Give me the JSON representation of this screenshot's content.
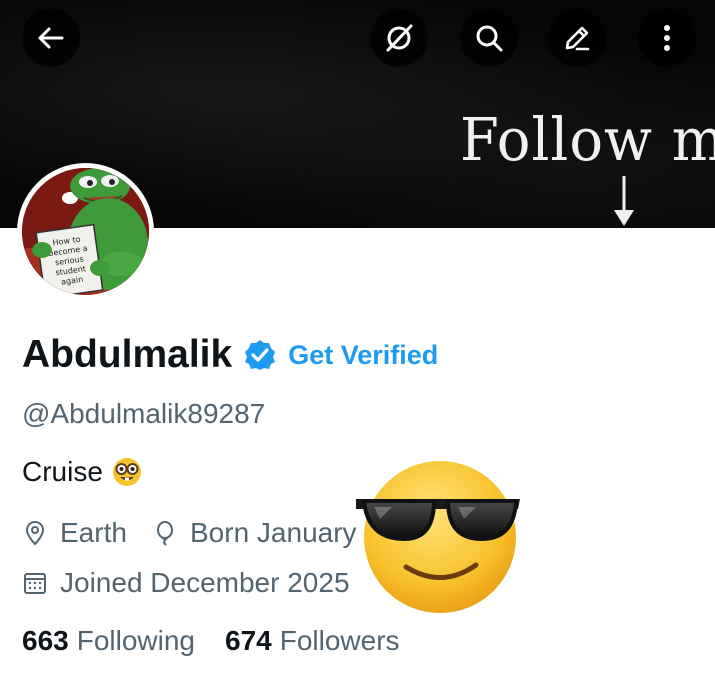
{
  "header": {
    "banner_text": "Follow me",
    "buttons": {
      "back": "back-arrow-icon",
      "grok": "grok-icon",
      "search": "search-icon",
      "edit": "pencil-icon",
      "more": "more-vertical-icon"
    }
  },
  "avatar": {
    "book_text": "How to become a serious student again"
  },
  "profile": {
    "display_name": "Abdulmalik",
    "verified_icon": "verified-badge-icon",
    "get_verified_label": "Get Verified",
    "handle": "@Abdulmalik89287",
    "bio": "Cruise",
    "bio_emoji": "nerd-face-emoji",
    "location": "Earth",
    "birthday": "Born January",
    "joined": "Joined December 2025"
  },
  "stats": {
    "following_count": "663",
    "following_label": "Following",
    "followers_count": "674",
    "followers_label": "Followers"
  },
  "overlay": {
    "sticker": "sunglasses-face-emoji"
  },
  "colors": {
    "accent": "#1d9bf0",
    "text_primary": "#0f1419",
    "text_secondary": "#536471",
    "banner_bg": "#050505"
  }
}
